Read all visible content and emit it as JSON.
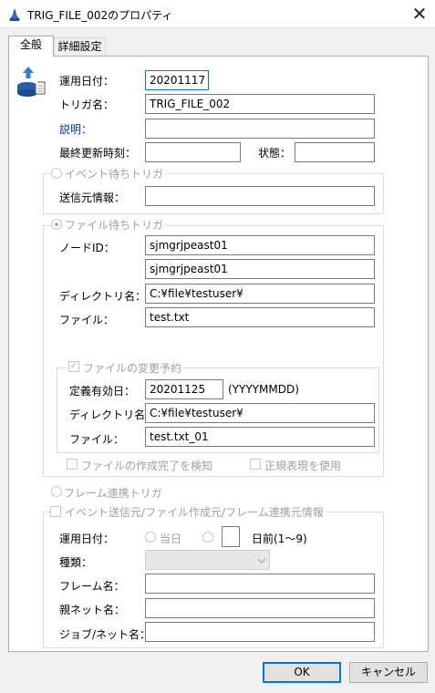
{
  "window": {
    "title": "TRIG_FILE_002のプロパティ",
    "close_glyph": "✕"
  },
  "tabs": [
    {
      "label": "全般"
    },
    {
      "label": "詳細設定"
    }
  ],
  "general": {
    "op_date_label": "運用日付：",
    "op_date_value": "20201117",
    "trigger_name_label": "トリガ名：",
    "trigger_name_value": "TRIG_FILE_002",
    "description_label": "説明：",
    "description_value": "",
    "last_updated_label": "最終更新時刻：",
    "last_updated_value": "",
    "status_label": "状態：",
    "status_value": ""
  },
  "event_trigger": {
    "title": "イベント待ちトリガ",
    "sender_label": "送信元情報：",
    "sender_value": ""
  },
  "file_trigger": {
    "title": "ファイル待ちトリガ",
    "node_label": "ノードID：",
    "node_value_1": "sjmgrjpeast01",
    "node_value_2": "sjmgrjpeast01",
    "dir_label": "ディレクトリ名：",
    "dir_value": "C:¥file¥testuser¥",
    "file_label": "ファイル：",
    "file_value": "test.txt",
    "change": {
      "title": "ファイルの変更予約",
      "checked": true,
      "effective_date_label": "定義有効日：",
      "effective_date_value": "20201125",
      "date_format": "(YYYYMMDD)",
      "dir_label": "ディレクトリ名：",
      "dir_value": "C:¥file¥testuser¥",
      "file_label": "ファイル：",
      "file_value": "test.txt_01"
    },
    "detect_complete_label": "ファイルの作成完了を検知",
    "regex_label": "正規表現を使用"
  },
  "frame_trigger": {
    "title": "フレーム連携トリガ",
    "info_title": "イベント送信元/ファイル作成元/フレーム連携元情報",
    "op_date_label": "運用日付：",
    "today_label": "当日",
    "days_before_value": "",
    "days_before_label": "日前(1〜9)",
    "type_label": "種類：",
    "type_value": "",
    "frame_name_label": "フレーム名：",
    "frame_name_value": "",
    "parent_net_label": "親ネット名：",
    "parent_net_value": "",
    "job_net_label": "ジョブ/ネット名：",
    "job_net_value": ""
  },
  "buttons": {
    "ok": "OK",
    "cancel": "キャンセル"
  },
  "colors": {
    "accent": "#0078d7",
    "disabled_text": "#a0a0a0"
  }
}
